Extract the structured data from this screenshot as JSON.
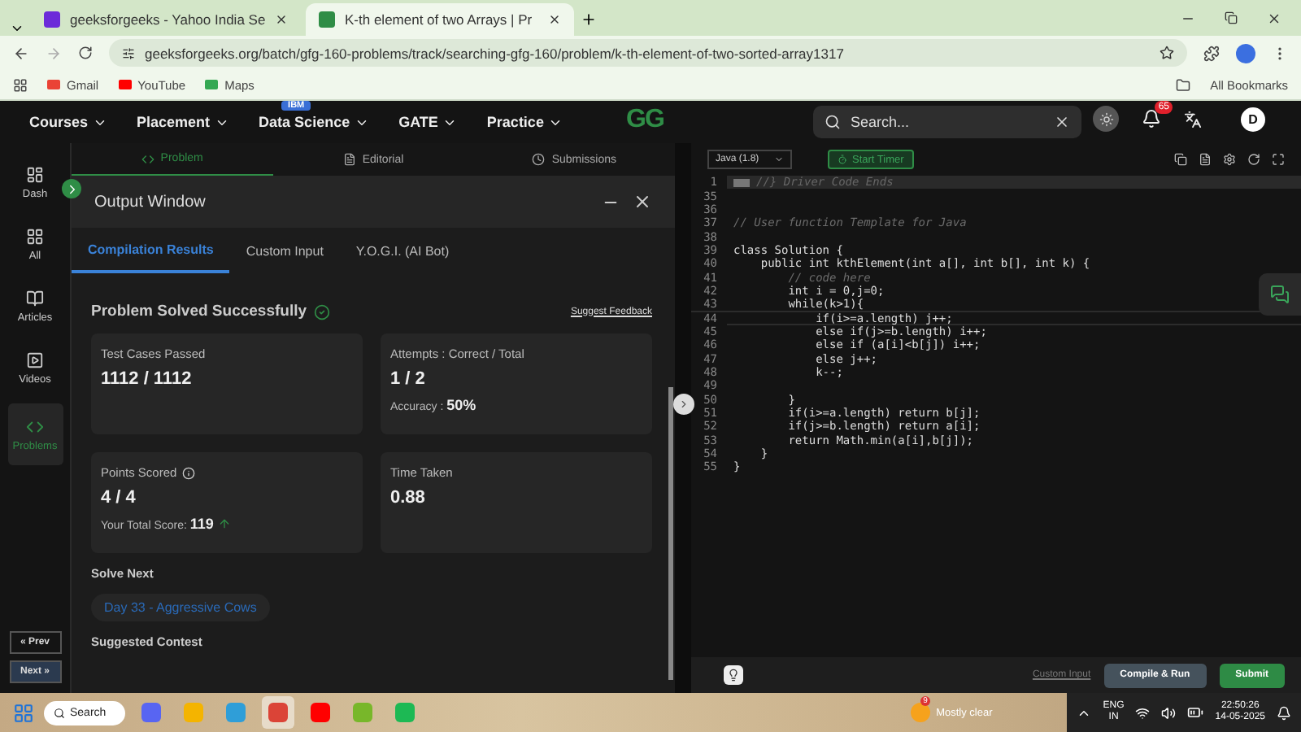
{
  "browser": {
    "tabs": [
      {
        "title": "geeksforgeeks - Yahoo India Se",
        "selected": false
      },
      {
        "title": "K-th element of two Arrays | Pr",
        "selected": true
      }
    ],
    "url": "geeksforgeeks.org/batch/gfg-160-problems/track/searching-gfg-160/problem/k-th-element-of-two-sorted-array1317",
    "bookmarks": [
      {
        "label": "Gmail",
        "color": "#ea4335"
      },
      {
        "label": "YouTube",
        "color": "#ff0000"
      },
      {
        "label": "Maps",
        "color": "#34a853"
      }
    ],
    "all_bookmarks": "All Bookmarks"
  },
  "nav": {
    "menus": [
      {
        "label": "Courses"
      },
      {
        "label": "Placement"
      },
      {
        "label": "Data Science",
        "badge": "IBM"
      },
      {
        "label": "GATE"
      },
      {
        "label": "Practice"
      }
    ],
    "logo": "GG",
    "search": {
      "placeholder": "Search..."
    },
    "notifications": "65",
    "avatar": "D"
  },
  "sidebar": {
    "items": [
      {
        "label": "Dash",
        "kind": "dash",
        "selected": false
      },
      {
        "label": "All",
        "kind": "all",
        "selected": false
      },
      {
        "label": "Articles",
        "kind": "articles",
        "selected": false
      },
      {
        "label": "Videos",
        "kind": "videos",
        "selected": false
      },
      {
        "label": "Problems",
        "kind": "problems",
        "selected": true
      }
    ],
    "prev": "« Prev",
    "next": "Next »"
  },
  "problem_tabs": [
    {
      "label": "Problem",
      "kind": "code",
      "selected": true
    },
    {
      "label": "Editorial",
      "kind": "file",
      "selected": false
    },
    {
      "label": "Submissions",
      "kind": "clock",
      "selected": false
    }
  ],
  "output": {
    "title": "Output Window",
    "tabs": [
      {
        "label": "Compilation Results",
        "selected": true
      },
      {
        "label": "Custom Input",
        "selected": false
      },
      {
        "label": "Y.O.G.I. (AI Bot)",
        "selected": false
      }
    ],
    "status": "Problem Solved Successfully",
    "feedback": "Suggest Feedback",
    "cards": [
      {
        "label": "Test Cases Passed",
        "value": "1112 / 1112"
      },
      {
        "label": "Attempts : Correct / Total",
        "value": "1 / 2",
        "note": "Accuracy : **50%**"
      },
      {
        "label": "Points Scored",
        "value": "4 / 4",
        "note": "Your Total Score: **119**",
        "info": true,
        "rising": true
      },
      {
        "label": "Time Taken",
        "value": "0.88"
      }
    ],
    "solve_next": "Solve Next",
    "next_problem": "Day 33 - Aggressive Cows",
    "suggested": "Suggested Contest"
  },
  "editor": {
    "language": "Java (1.8)",
    "timer": "Start Timer",
    "lines": [
      {
        "number": "1",
        "text": "//} Driver Code Ends",
        "kind": "folded",
        "active": false
      },
      {
        "number": "35",
        "kind": "code",
        "active": false
      },
      {
        "number": "36",
        "kind": "code",
        "active": false
      },
      {
        "number": "37",
        "text": "// User function Template for Java",
        "kind": "comment",
        "active": false
      },
      {
        "number": "38",
        "kind": "code",
        "active": false
      },
      {
        "number": "39",
        "text": "class Solution {",
        "kind": "code",
        "active": false
      },
      {
        "number": "40",
        "text": "    public int kthElement(int a[], int b[], int k) {",
        "kind": "code",
        "active": false
      },
      {
        "number": "41",
        "text": "        // code here",
        "kind": "comment",
        "active": false
      },
      {
        "number": "42",
        "text": "        int i = 0,j=0;",
        "kind": "code",
        "active": false
      },
      {
        "number": "43",
        "text": "        while(k>1){",
        "kind": "code",
        "active": false
      },
      {
        "number": "44",
        "text": "            if(i>=a.length) j++;",
        "kind": "code",
        "active": true
      },
      {
        "number": "45",
        "text": "            else if(j>=b.length) i++;",
        "kind": "code",
        "active": false
      },
      {
        "number": "46",
        "text": "            else if (a[i]<b[j]) i++;",
        "kind": "code",
        "active": false
      },
      {
        "number": "47",
        "text": "            else j++;",
        "kind": "code",
        "active": false
      },
      {
        "number": "48",
        "text": "            k--;",
        "kind": "code",
        "active": false
      },
      {
        "number": "49",
        "kind": "code",
        "active": false
      },
      {
        "number": "50",
        "text": "        }",
        "kind": "code",
        "active": false
      },
      {
        "number": "51",
        "text": "        if(i>=a.length) return b[j];",
        "kind": "code",
        "active": false
      },
      {
        "number": "52",
        "text": "        if(j>=b.length) return a[i];",
        "kind": "code",
        "active": false
      },
      {
        "number": "53",
        "text": "        return Math.min(a[i],b[j]);",
        "kind": "code",
        "active": false
      },
      {
        "number": "54",
        "text": "    }",
        "kind": "code",
        "active": false
      },
      {
        "number": "55",
        "text": "}",
        "kind": "code",
        "active": false
      }
    ],
    "custom_input": "Custom Input",
    "compile": "Compile & Run",
    "submit": "Submit"
  },
  "taskbar": {
    "search": "Search",
    "apps": [
      {
        "color": "#5865f2",
        "selected": false
      },
      {
        "color": "#f4b400",
        "selected": false
      },
      {
        "color": "#2f9ed8",
        "selected": false
      },
      {
        "color": "#db4437",
        "selected": true
      },
      {
        "color": "#ff0000",
        "selected": false
      },
      {
        "color": "#78b72a",
        "selected": false
      },
      {
        "color": "#1db954",
        "selected": false
      }
    ],
    "weather_badge": "9",
    "weather": "Mostly clear",
    "lang": "ENG",
    "region": "IN",
    "time": "22:50:26",
    "date": "14-05-2025"
  }
}
